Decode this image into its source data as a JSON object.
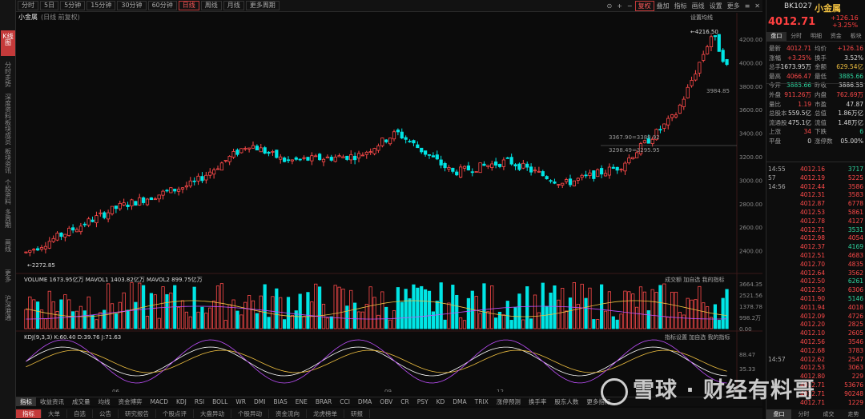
{
  "periods": [
    "分时",
    "5日",
    "5分钟",
    "15分钟",
    "30分钟",
    "60分钟",
    "日线",
    "周线",
    "月线",
    "更多周期"
  ],
  "toolbar": [
    "复权",
    "叠加",
    "指标",
    "画线",
    "设置",
    "更多"
  ],
  "sidebar": [
    "K线图",
    "分时走势",
    "深度资料",
    "板块成员",
    "板块资讯",
    "个股资料",
    "多周期",
    "画线",
    "更多",
    "沪深港通"
  ],
  "chart_title": "小金属",
  "chart_subtitle": "(日线 前复权)",
  "chart_setting": "设置均线",
  "price_axis": [
    "4200.00",
    "4000.00",
    "3800.00",
    "3600.00",
    "3400.00",
    "3200.00",
    "3000.00",
    "2800.00",
    "2600.00",
    "2400.00"
  ],
  "vol_axis": [
    "3664.35",
    "2521.56",
    "1378.78",
    "998.2万",
    "0.00"
  ],
  "kdj_axis": [
    "88.47",
    "35.33"
  ],
  "annotations": {
    "hi": "4216.50",
    "lo": "2272.85",
    "mid1": "3367.90=3389.92",
    "mid2": "3298.49=3295.95",
    "cur": "3984.85"
  },
  "vol_legend": "VOLUME 1673.95亿万  MAVOL1 1403.82亿万  MAVOL2 899.75亿万",
  "vol_right": "成交额  加自选  我的指标",
  "kdj_legend": "KDJ(9,3,3) K:60.40 D:39.76 J:71.63",
  "kdj_right": "指标设置  加自选  我的指标",
  "x_dates": [
    "06",
    "09",
    "12"
  ],
  "indicators": [
    "指标",
    "收益资讯",
    "成交量",
    "均线",
    "资金博弈",
    "MACD",
    "KDJ",
    "RSI",
    "BOLL",
    "WR",
    "DMI",
    "BIAS",
    "ENE",
    "BRAR",
    "CCI",
    "DMA",
    "OBV",
    "CR",
    "PSY",
    "KD",
    "DMA",
    "TRIX",
    "涨停预测",
    "换手率",
    "股东人数",
    "更多指标"
  ],
  "footer": [
    "指标",
    "大单",
    "自选",
    "公告",
    "研究报告",
    "个股点评",
    "大盘异动",
    "个股异动",
    "资金流向",
    "龙虎榜单",
    "研报"
  ],
  "rp": {
    "code": "BK1027",
    "name": "小金属",
    "price": "4012.71",
    "chg": "+126.16",
    "pct": "+3.25%",
    "tabs": [
      "盘口",
      "分时",
      "明细",
      "资金",
      "板块"
    ],
    "rows": [
      [
        "最新",
        "4012.71",
        "red",
        "均价",
        "+126.16",
        "red"
      ],
      [
        "涨幅",
        "+3.25%",
        "red",
        "换手",
        "3.52%",
        "wht"
      ],
      [
        "总手",
        "1673.95万",
        "wht",
        "金额",
        "629.54亿",
        "yel"
      ],
      [
        "最高",
        "4066.47",
        "red",
        "最低",
        "3885.66",
        "grn"
      ],
      [
        "今开",
        "3885.66",
        "grn",
        "昨收",
        "3886.55",
        "wht"
      ],
      [
        "外盘",
        "911.26万",
        "red",
        "内盘",
        "762.69万",
        "red"
      ],
      [
        "量比",
        "1.19",
        "red",
        "市盈",
        "47.87",
        "wht"
      ],
      [
        "总股本",
        "559.5亿",
        "wht",
        "总值",
        "1.86万亿",
        "wht"
      ],
      [
        "流通股",
        "475.1亿",
        "wht",
        "流值",
        "1.48万亿",
        "wht"
      ],
      [
        "上涨",
        "34",
        "red",
        "下跌",
        "6",
        "grn"
      ],
      [
        "平盘",
        "0",
        "wht",
        "涨停数",
        "05.00%",
        "wht"
      ]
    ],
    "ticks": [
      [
        "14:55",
        "4012.16",
        "3717",
        "grn"
      ],
      [
        "57",
        "4012.19",
        "5225",
        "red"
      ],
      [
        "14:56",
        "4012.44",
        "3586",
        "red"
      ],
      [
        "",
        "4012.31",
        "3583",
        "red"
      ],
      [
        "",
        "4012.87",
        "6778",
        "red"
      ],
      [
        "",
        "4012.53",
        "5861",
        "red"
      ],
      [
        "",
        "4012.78",
        "4127",
        "red"
      ],
      [
        "",
        "4012.71",
        "3531",
        "grn"
      ],
      [
        "",
        "4012.98",
        "4054",
        "red"
      ],
      [
        "",
        "4012.37",
        "4169",
        "grn"
      ],
      [
        "",
        "4012.51",
        "4683",
        "red"
      ],
      [
        "",
        "4012.70",
        "4835",
        "red"
      ],
      [
        "",
        "4012.64",
        "3562",
        "red"
      ],
      [
        "",
        "4012.50",
        "6261",
        "grn"
      ],
      [
        "",
        "4012.50",
        "6306",
        "red"
      ],
      [
        "",
        "4011.90",
        "5146",
        "grn"
      ],
      [
        "",
        "4011.94",
        "4018",
        "red"
      ],
      [
        "",
        "4012.09",
        "4726",
        "red"
      ],
      [
        "",
        "4012.20",
        "2825",
        "red"
      ],
      [
        "",
        "4012.10",
        "2605",
        "red"
      ],
      [
        "",
        "4012.56",
        "3546",
        "red"
      ],
      [
        "",
        "4012.68",
        "3783",
        "red"
      ],
      [
        "14:57",
        "4012.62",
        "2547",
        "red"
      ],
      [
        "",
        "4012.53",
        "3063",
        "red"
      ],
      [
        "",
        "4012.80",
        "229",
        "red"
      ],
      [
        "",
        "4012.71",
        "53676",
        "red"
      ],
      [
        "",
        "4012.71",
        "90248",
        "red"
      ],
      [
        "",
        "4012.71",
        "1229",
        "red"
      ]
    ],
    "rfoot": [
      "盘口",
      "分时",
      "成交",
      "走势"
    ]
  },
  "watermark": "雪球 · 财经有料哥",
  "chart_data": {
    "type": "candlestick",
    "title": "小金属",
    "ylim": [
      2200,
      4300
    ],
    "hi": 4216.5,
    "lo": 2272.85,
    "last": 4012.71
  }
}
